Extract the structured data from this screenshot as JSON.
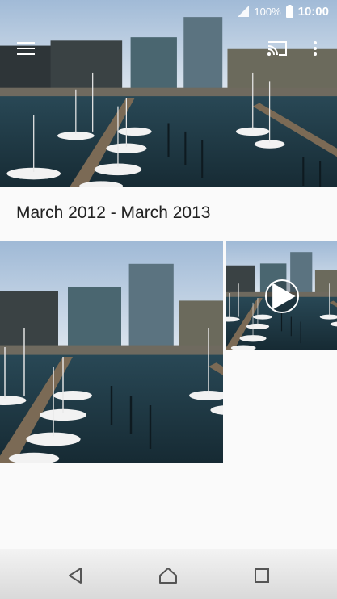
{
  "status_bar": {
    "battery_percent": "100%",
    "time": "10:00",
    "icons": [
      "signal-icon",
      "battery-icon"
    ]
  },
  "app_bar": {
    "icons": [
      "menu-icon",
      "cast-icon",
      "more-vert-icon"
    ]
  },
  "album": {
    "date_range": "March 2012 - March 2013",
    "items": [
      {
        "type": "photo"
      },
      {
        "type": "video"
      }
    ]
  },
  "nav_bar": {
    "icons": [
      "back-icon",
      "home-icon",
      "recents-icon"
    ]
  },
  "colors": {
    "sky": "#c8d8ea",
    "water": "#1f3a48",
    "background": "#fafafa"
  }
}
